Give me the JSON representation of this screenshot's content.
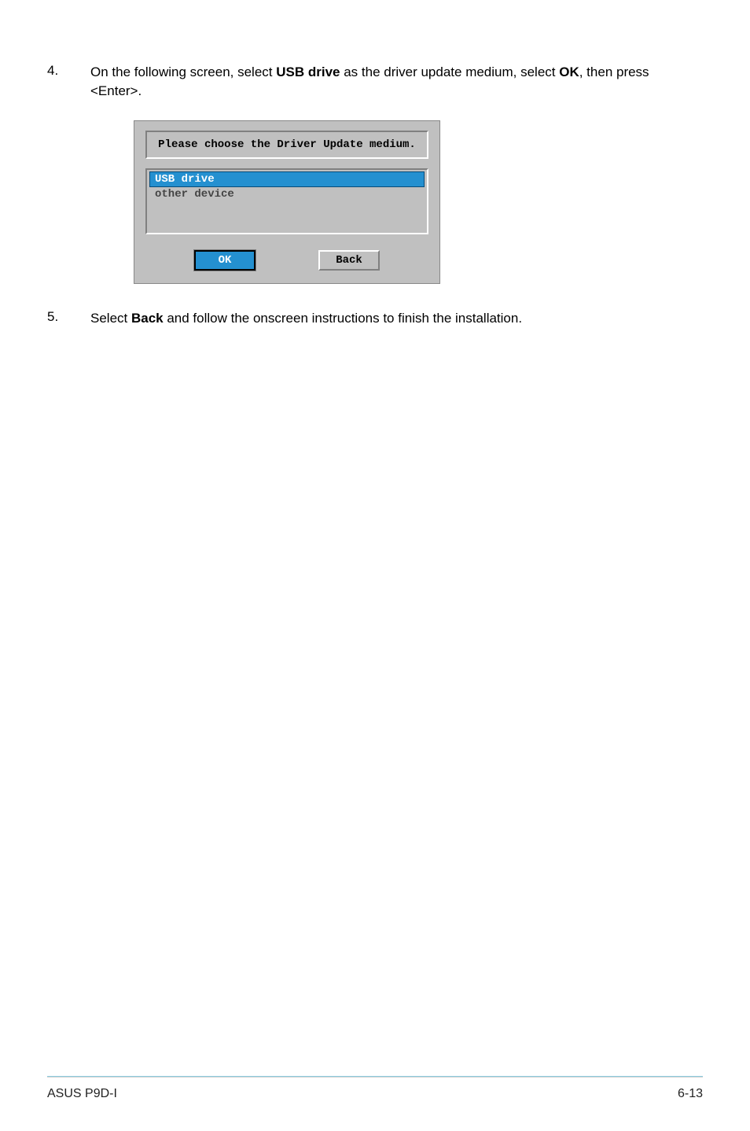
{
  "steps": {
    "s4": {
      "num": "4.",
      "text_prefix": "On the following screen, select ",
      "bold1": "USB drive",
      "text_mid": " as the driver update medium, select ",
      "bold2": "OK",
      "text_suffix": ", then press <Enter>."
    },
    "s5": {
      "num": "5.",
      "text_prefix": "Select ",
      "bold1": "Back",
      "text_suffix": " and follow the onscreen instructions to finish the installation."
    }
  },
  "dialog": {
    "title": "Please choose the Driver Update medium.",
    "items": {
      "selected": "USB drive",
      "other": "other device"
    },
    "buttons": {
      "ok": "OK",
      "back": "Back"
    }
  },
  "footer": {
    "left": "ASUS P9D-I",
    "right": "6-13"
  }
}
